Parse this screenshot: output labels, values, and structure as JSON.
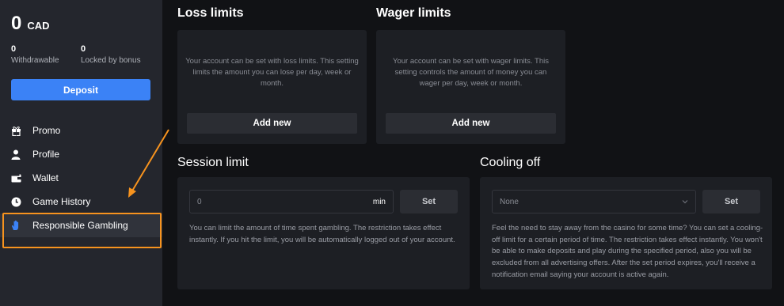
{
  "sidebar": {
    "balance_amount": "0",
    "balance_currency": "CAD",
    "withdrawable_value": "0",
    "withdrawable_label": "Withdrawable",
    "locked_value": "0",
    "locked_label": "Locked by bonus",
    "deposit_label": "Deposit",
    "items": [
      {
        "label": "Promo",
        "icon": "gift-icon"
      },
      {
        "label": "Profile",
        "icon": "user-icon"
      },
      {
        "label": "Wallet",
        "icon": "wallet-icon"
      },
      {
        "label": "Game History",
        "icon": "clock-icon"
      },
      {
        "label": "Responsible Gambling",
        "icon": "hand-icon",
        "active": true
      }
    ]
  },
  "loss_limits": {
    "title": "Loss limits",
    "text": "Your account can be set with loss limits. This setting limits the amount you can lose per day, week or month.",
    "button": "Add new"
  },
  "wager_limits": {
    "title": "Wager limits",
    "text": "Your account can be set with wager limits. This setting controls the amount of money you can wager per day, week or month.",
    "button": "Add new"
  },
  "session_limit": {
    "title": "Session limit",
    "input_value": "0",
    "unit": "min",
    "button": "Set",
    "description": "You can limit the amount of time spent gambling. The restriction takes effect instantly. If you hit the limit, you will be automatically logged out of your account."
  },
  "cooling_off": {
    "title": "Cooling off",
    "select_value": "None",
    "button": "Set",
    "description": "Feel the need to stay away from the casino for some time? You can set a cooling-off limit for a certain period of time. The restriction takes effect instantly. You won't be able to make deposits and play during the specified period, also you will be excluded from all advertising offers. After the set period expires, you'll receive a notification email saying your account is active again."
  },
  "colors": {
    "accent_blue": "#3b82f6",
    "highlight_orange": "#f7931e"
  }
}
